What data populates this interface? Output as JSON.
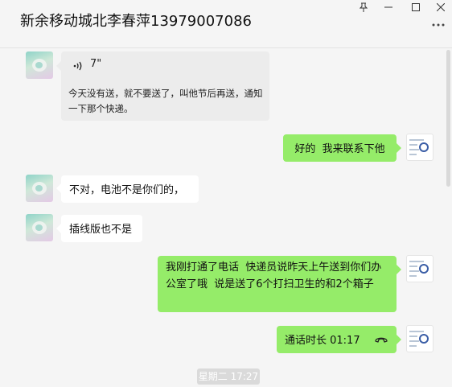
{
  "window": {
    "title": "新余移动城北李春萍13979007086",
    "controls": {
      "pin": "pin-icon",
      "minimize": "minimize-icon",
      "maximize": "maximize-icon",
      "close": "close-icon"
    },
    "more": "more-icon"
  },
  "messages": [
    {
      "side": "left",
      "type": "voice",
      "duration": "7\"",
      "transcript": "今天没有送，就不要送了，叫他节后再送，通知一下那个快递。"
    },
    {
      "side": "right",
      "type": "text",
      "text": "好的  我来联系下他"
    },
    {
      "side": "left",
      "type": "text",
      "text": "不对，电池不是你们的，"
    },
    {
      "side": "left",
      "type": "text",
      "text": "插线版也不是"
    },
    {
      "side": "right",
      "type": "text",
      "text": "我刚打通了电话  快递员说昨天上午送到你们办公室了哦  说是送了6个打扫卫生的和2个箱子"
    },
    {
      "side": "right",
      "type": "call",
      "text": "通话时长 01:17"
    }
  ],
  "timestamp": "星期二 17:27",
  "colors": {
    "sent_bubble": "#95ec69",
    "received_bubble": "#ffffff",
    "voice_bubble": "#ececec",
    "background": "#f5f5f5"
  }
}
